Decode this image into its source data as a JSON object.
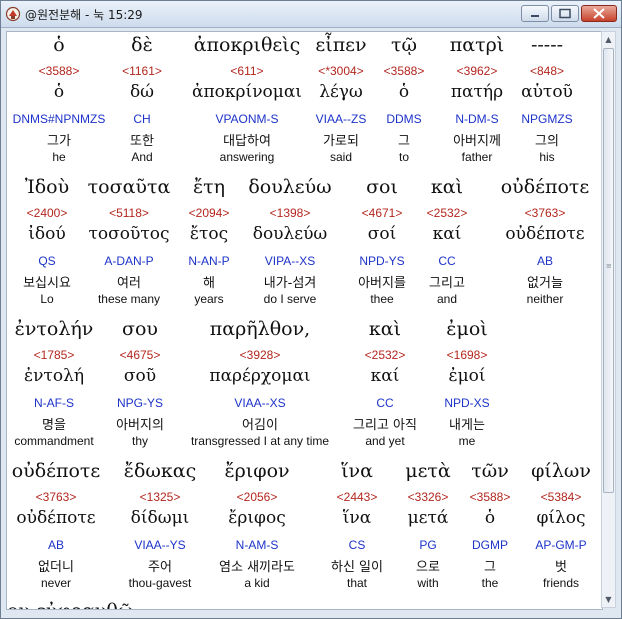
{
  "window": {
    "title": "@원전분해 - 눅 15:29",
    "minimize_label": "minimize",
    "maximize_label": "maximize",
    "close_label": "close"
  },
  "rows": [
    {
      "words": [
        {
          "greek": "ὁ",
          "strong": "<3588>",
          "lemma": "ὁ",
          "parse": "DNMS#NPNMZS",
          "korean": "그가",
          "english": "he"
        },
        {
          "greek": "δὲ",
          "strong": "<1161>",
          "lemma": "δώ",
          "parse": "CH",
          "korean": "또한",
          "english": "And"
        },
        {
          "greek": "ἀποκριθεὶς",
          "strong": "<611>",
          "lemma": "ἀποκρίνομαι",
          "parse": "VPAONM-S",
          "korean": "대답하여",
          "english": "answering"
        },
        {
          "greek": "εἶπεν",
          "strong": "<*3004>",
          "lemma": "λέγω",
          "parse": "VIAA--ZS",
          "korean": "가로되",
          "english": "said"
        },
        {
          "greek": "τῷ",
          "strong": "<3588>",
          "lemma": "ὁ",
          "parse": "DDMS",
          "korean": "그",
          "english": "to"
        },
        {
          "greek": "πατρὶ",
          "strong": "<3962>",
          "lemma": "πατήρ",
          "parse": "N-DM-S",
          "korean": "아버지께",
          "english": "father"
        },
        {
          "greek": "-----",
          "strong": "<848>",
          "lemma": "αὑτοῦ",
          "parse": "NPGMZS",
          "korean": "그의",
          "english": "his"
        }
      ]
    },
    {
      "words": [
        {
          "greek": "Ἰδοὺ",
          "strong": "<2400>",
          "lemma": "ἰδού",
          "parse": "QS",
          "korean": "보십시요",
          "english": "Lo"
        },
        {
          "greek": "τοσαῦτα",
          "strong": "<5118>",
          "lemma": "τοσοῦτος",
          "parse": "A-DAN-P",
          "korean": "여러",
          "english": "these many"
        },
        {
          "greek": "ἔτη",
          "strong": "<2094>",
          "lemma": "ἔτος",
          "parse": "N-AN-P",
          "korean": "해",
          "english": "years"
        },
        {
          "greek": "δουλεύω",
          "strong": "<1398>",
          "lemma": "δουλεύω",
          "parse": "VIPA--XS",
          "korean": "내가-섬겨",
          "english": "do I serve"
        },
        {
          "greek": "σοι",
          "strong": "<4671>",
          "lemma": "σοί",
          "parse": "NPD-YS",
          "korean": "아버지를",
          "english": "thee"
        },
        {
          "greek": "καὶ",
          "strong": "<2532>",
          "lemma": "καί",
          "parse": "CC",
          "korean": "그리고",
          "english": "and"
        },
        {
          "greek": "οὐδέποτε",
          "strong": "<3763>",
          "lemma": "οὐδέποτε",
          "parse": "AB",
          "korean": "없거늘",
          "english": "neither"
        }
      ]
    },
    {
      "words": [
        {
          "greek": "ἐντολήν",
          "strong": "<1785>",
          "lemma": "ἐντολή",
          "parse": "N-AF-S",
          "korean": "명을",
          "english": "commandment"
        },
        {
          "greek": "σου",
          "strong": "<4675>",
          "lemma": "σοῦ",
          "parse": "NPG-YS",
          "korean": "아버지의",
          "english": "thy"
        },
        {
          "greek": "παρῆλθον,",
          "strong": "<3928>",
          "lemma": "παρέρχομαι",
          "parse": "VIAA--XS",
          "korean": "어김이",
          "english": "transgressed I at any time"
        },
        {
          "greek": "καὶ",
          "strong": "<2532>",
          "lemma": "καί",
          "parse": "CC",
          "korean": "그리고 아직",
          "english": "and yet"
        },
        {
          "greek": "ἐμοὶ",
          "strong": "<1698>",
          "lemma": "ἐμοί",
          "parse": "NPD-XS",
          "korean": "내게는",
          "english": "me"
        }
      ]
    },
    {
      "words": [
        {
          "greek": "οὐδέποτε",
          "strong": "<3763>",
          "lemma": "οὐδέποτε",
          "parse": "AB",
          "korean": "없더니",
          "english": "never"
        },
        {
          "greek": "ἔδωκας",
          "strong": "<1325>",
          "lemma": "δίδωμι",
          "parse": "VIAA--YS",
          "korean": "주어",
          "english": "thou-gavest"
        },
        {
          "greek": "ἔριφον",
          "strong": "<2056>",
          "lemma": "ἔριφος",
          "parse": "N-AM-S",
          "korean": "염소 새끼라도",
          "english": "a kid"
        },
        {
          "greek": "ἵνα",
          "strong": "<2443>",
          "lemma": "ἵνα",
          "parse": "CS",
          "korean": "하신 일이",
          "english": "that"
        },
        {
          "greek": "μετὰ",
          "strong": "<3326>",
          "lemma": "μετά",
          "parse": "PG",
          "korean": "으로",
          "english": "with"
        },
        {
          "greek": "τῶν",
          "strong": "<3588>",
          "lemma": "ὁ",
          "parse": "DGMP",
          "korean": "그",
          "english": "the"
        },
        {
          "greek": "φίλων",
          "strong": "<5384>",
          "lemma": "φίλος",
          "parse": "AP-GM-P",
          "korean": "벗",
          "english": "friends"
        }
      ]
    }
  ],
  "partial_next_line": "μου  εὐφρανθῶ·"
}
